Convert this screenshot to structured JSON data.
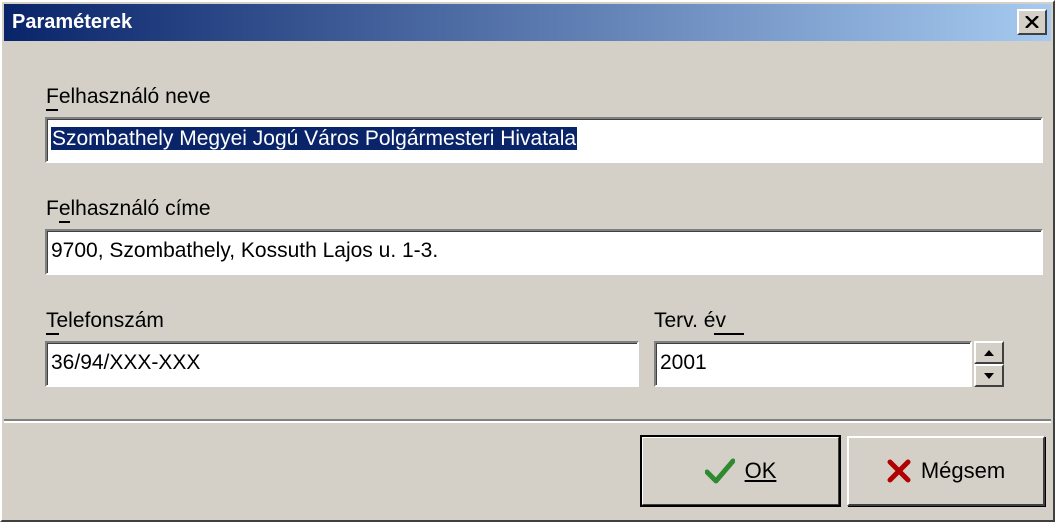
{
  "window": {
    "title": "Paraméterek"
  },
  "fields": {
    "user_name": {
      "label": "Felhasználó neve",
      "value": "Szombathely Megyei Jogú Város Polgármesteri Hivatala"
    },
    "user_address": {
      "label": "Felhasználó címe",
      "value": "9700, Szombathely, Kossuth Lajos u. 1-3."
    },
    "phone": {
      "label": "Telefonszám",
      "value": "36/94/XXX-XXX"
    },
    "plan_year": {
      "label": "Terv. év",
      "value": "2001"
    }
  },
  "buttons": {
    "ok": {
      "label": "OK",
      "icon": "checkmark-icon",
      "color": "#2f8a2f"
    },
    "cancel": {
      "label": "Mégsem",
      "icon": "cross-icon",
      "color": "#b00000"
    }
  },
  "colors": {
    "title_start": "#0a246a",
    "title_end": "#a6caf0",
    "face": "#d4d0c8",
    "selection": "#0a246a"
  }
}
